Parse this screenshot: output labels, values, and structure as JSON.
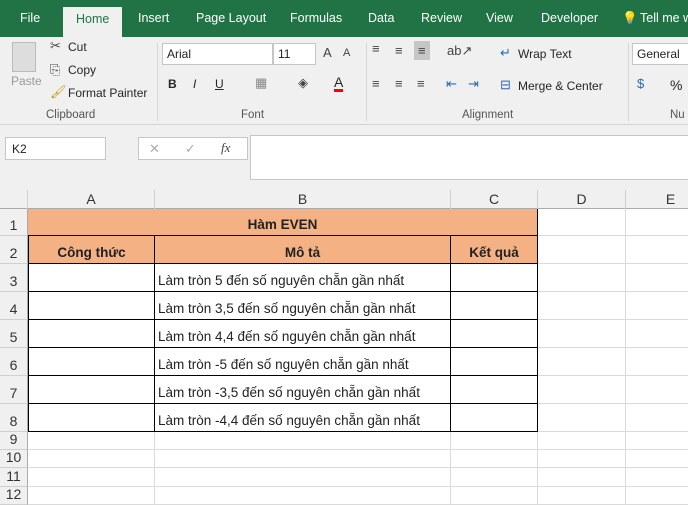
{
  "tabs": [
    "File",
    "Home",
    "Insert",
    "Page Layout",
    "Formulas",
    "Data",
    "Review",
    "View",
    "Developer",
    "Tell me w"
  ],
  "ribbon": {
    "clipboard": {
      "paste": "Paste",
      "cut": "Cut",
      "copy": "Copy",
      "format_painter": "Format Painter",
      "group": "Clipboard"
    },
    "font": {
      "name": "Arial",
      "size": "11",
      "bold": "B",
      "italic": "I",
      "underline": "U",
      "font_color": "A",
      "group": "Font",
      "font_color_hex": "#ff0000"
    },
    "alignment": {
      "wrap_text": "Wrap Text",
      "merge_center": "Merge & Center",
      "group": "Alignment"
    },
    "number": {
      "format": "General",
      "percent": "%",
      "group": "Nu"
    }
  },
  "formula_bar": {
    "name_box": "K2",
    "cancel": "✕",
    "enter": "✓",
    "fx": "fx",
    "value": ""
  },
  "columns": [
    "A",
    "B",
    "C",
    "D",
    "E"
  ],
  "rows": [
    "1",
    "2",
    "3",
    "4",
    "5",
    "6",
    "7",
    "8",
    "9",
    "10",
    "11",
    "12"
  ],
  "sheet": {
    "title": "Hàm EVEN",
    "headers": [
      "Công thức",
      "Mô tả",
      "Kết quả"
    ],
    "descriptions": [
      "Làm tròn 5 đến số nguyên chẵn gần nhất",
      "Làm tròn 3,5 đến số nguyên chẵn gần nhất",
      "Làm tròn 4,4 đến số nguyên chẵn gần nhất",
      "Làm tròn -5 đến số nguyên chẵn gần nhất",
      "Làm tròn -3,5 đến số nguyên chẵn gần nhất",
      "Làm tròn -4,4 đến số nguyên chẵn gần nhất"
    ],
    "header_fill": "#f4b183"
  }
}
